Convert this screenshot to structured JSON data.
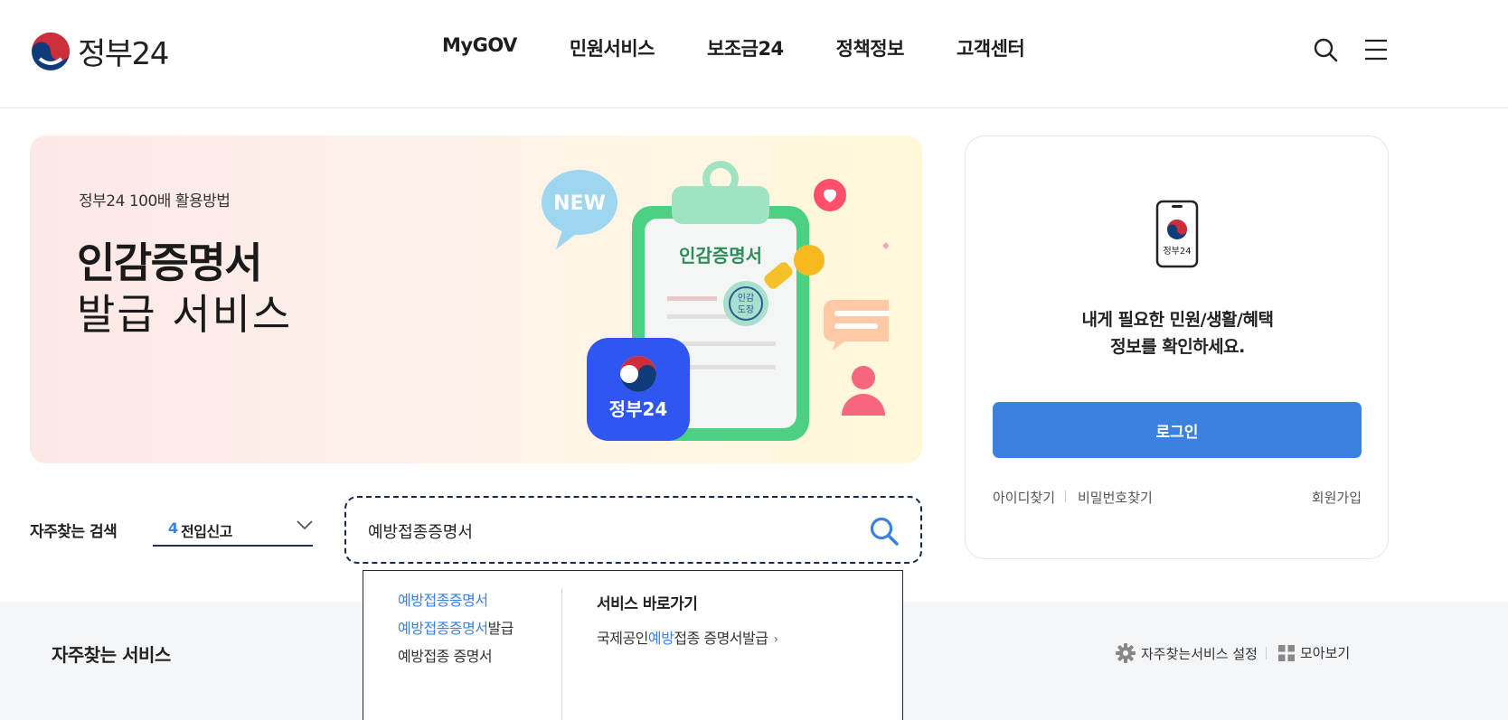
{
  "header": {
    "logo_text": "정부24",
    "nav": [
      "MyGOV",
      "민원서비스",
      "보조금24",
      "정책정보",
      "고객센터"
    ],
    "search_icon": "search-icon",
    "menu_icon": "hamburger-menu-icon"
  },
  "banner": {
    "subtitle": "정부24 100배 활용방법",
    "title_line1": "인감증명서",
    "title_line2": "발급 서비스",
    "badge_new": "NEW",
    "clipboard_label": "인감증명서",
    "stamp_label_1": "인감",
    "stamp_label_2": "도장",
    "app_label": "정부24"
  },
  "login": {
    "phone_label": "정부24",
    "message_line1": "내게 필요한 민원/생활/혜택",
    "message_line2": "정보를 확인하세요.",
    "button": "로그인",
    "find_id": "아이디찾기",
    "find_pw": "비밀번호찾기",
    "signup": "회원가입"
  },
  "search": {
    "fav_label": "자주찾는 검색",
    "fav_rank": "4",
    "fav_value": "전입신고",
    "query": "예방접종증명서"
  },
  "autocomplete": {
    "items": [
      {
        "highlight": "예방접종증명서",
        "rest": ""
      },
      {
        "highlight": "예방접종증명서",
        "rest": "발급"
      },
      {
        "highlight": "",
        "rest": "예방접종 증명서"
      }
    ],
    "quick_title": "서비스 바로가기",
    "quick_link_pre": "국제공인",
    "quick_link_hl": "예방",
    "quick_link_post": "접종 증명서발급"
  },
  "bottom": {
    "title": "자주찾는 서비스",
    "setting": "자주찾는서비스 설정",
    "collect": "모아보기"
  },
  "colors": {
    "accent": "#3b82e0",
    "navy": "#16284e",
    "taegeuk_red": "#cd2e3a",
    "taegeuk_blue": "#0f3b7a"
  }
}
